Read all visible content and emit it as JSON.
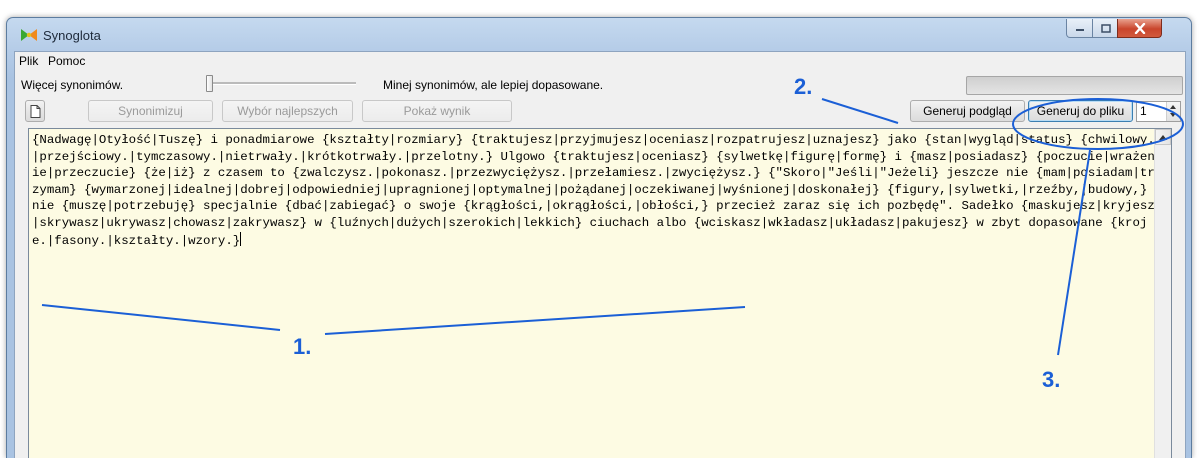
{
  "window": {
    "title": "Synoglota",
    "minimize_label": "–",
    "maximize_label": "▭",
    "close_label": "X"
  },
  "menu": {
    "items": [
      "Plik",
      "Pomoc"
    ]
  },
  "slider": {
    "left_label": "Więcej synonimów.",
    "right_label": "Minej synonimów, ale lepiej dopasowane.",
    "level": 0
  },
  "progress": {
    "value": 0
  },
  "toolbar": {
    "new_icon": "page-icon",
    "synonimizuj": "Synonimizuj",
    "wybor": "Wybór najlepszych",
    "pokaz": "Pokaż wynik",
    "preview": "Generuj podgląd",
    "to_file": "Generuj do pliku",
    "count": "1"
  },
  "editor": {
    "text": "{Nadwagę|Otyłość|Tuszę} i ponadmiarowe {kształty|rozmiary} {traktujesz|przyjmujesz|oceniasz|rozpatrujesz|uznajesz} jako {stan|wygląd|status} {chwilowy.|przejściowy.|tymczasowy.|nietrwały.|krótkotrwały.|przelotny.} Ulgowo {traktujesz|oceniasz} {sylwetkę|figurę|formę} i {masz|posiadasz} {poczucie|wrażenie|przeczucie} {że|iż} z czasem to {zwalczysz.|pokonasz.|przezwyciężysz.|przełamiesz.|zwyciężysz.} {\"Skoro|\"Jeśli|\"Jeżeli} jeszcze nie {mam|posiadam|trzymam} {wymarzonej|idealnej|dobrej|odpowiedniej|upragnionej|optymalnej|pożądanej|oczekiwanej|wyśnionej|doskonałej} {figury,|sylwetki,|rzeźby,|budowy,} nie {muszę|potrzebuję} specjalnie {dbać|zabiegać} o swoje {krągłości,|okrągłości,|obłości,} przecież zaraz się ich pozbędę\". Sadełko {maskujesz|kryjesz|skrywasz|ukrywasz|chowasz|zakrywasz} w {luźnych|dużych|szerokich|lekkich} ciuchach albo {wciskasz|wkładasz|układasz|pakujesz} w zbyt dopasowane {kroje.|fasony.|kształty.|wzory.}"
  },
  "annotations": {
    "one": "1.",
    "two": "2.",
    "three": "3.",
    "color": "#1b5fd6"
  }
}
